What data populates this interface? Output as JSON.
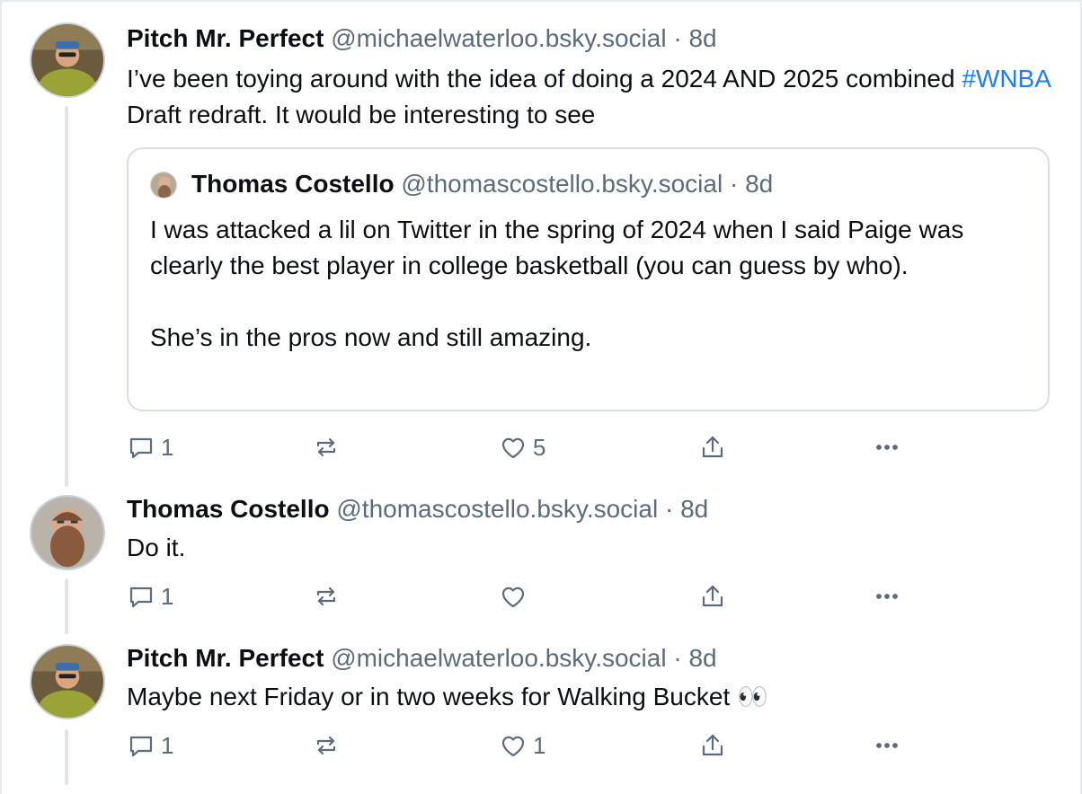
{
  "posts": [
    {
      "author": "Pitch Mr. Perfect",
      "handle": "@michaelwaterloo.bsky.social",
      "age": "8d",
      "text_before": "I’ve been toying around with the idea of doing a 2024 AND 2025 combined ",
      "hashtag": "#WNBA",
      "text_after": " Draft redraft. It would be interesting to see",
      "quote": {
        "author": "Thomas Costello",
        "handle": "@thomascostello.bsky.social",
        "age": "8d",
        "text_p1": "I was attacked a lil on Twitter in the spring of 2024 when I said Paige was clearly the best player in college basketball (you can guess by who).",
        "text_p2": "She’s in the pros now and still amazing."
      },
      "replies_count": "1",
      "reposts_count": "",
      "likes_count": "5"
    },
    {
      "author": "Thomas Costello",
      "handle": "@thomascostello.bsky.social",
      "age": "8d",
      "text": "Do it.",
      "replies_count": "1",
      "reposts_count": "",
      "likes_count": ""
    },
    {
      "author": "Pitch Mr. Perfect",
      "handle": "@michaelwaterloo.bsky.social",
      "age": "8d",
      "text": "Maybe next Friday or in two weeks for Walking Bucket 👀",
      "replies_count": "1",
      "reposts_count": "",
      "likes_count": "1"
    }
  ],
  "separator": " · ",
  "colors": {
    "hashtag": "#1d7ff0",
    "muted": "#5b6b7c",
    "border": "#d9dee4"
  }
}
